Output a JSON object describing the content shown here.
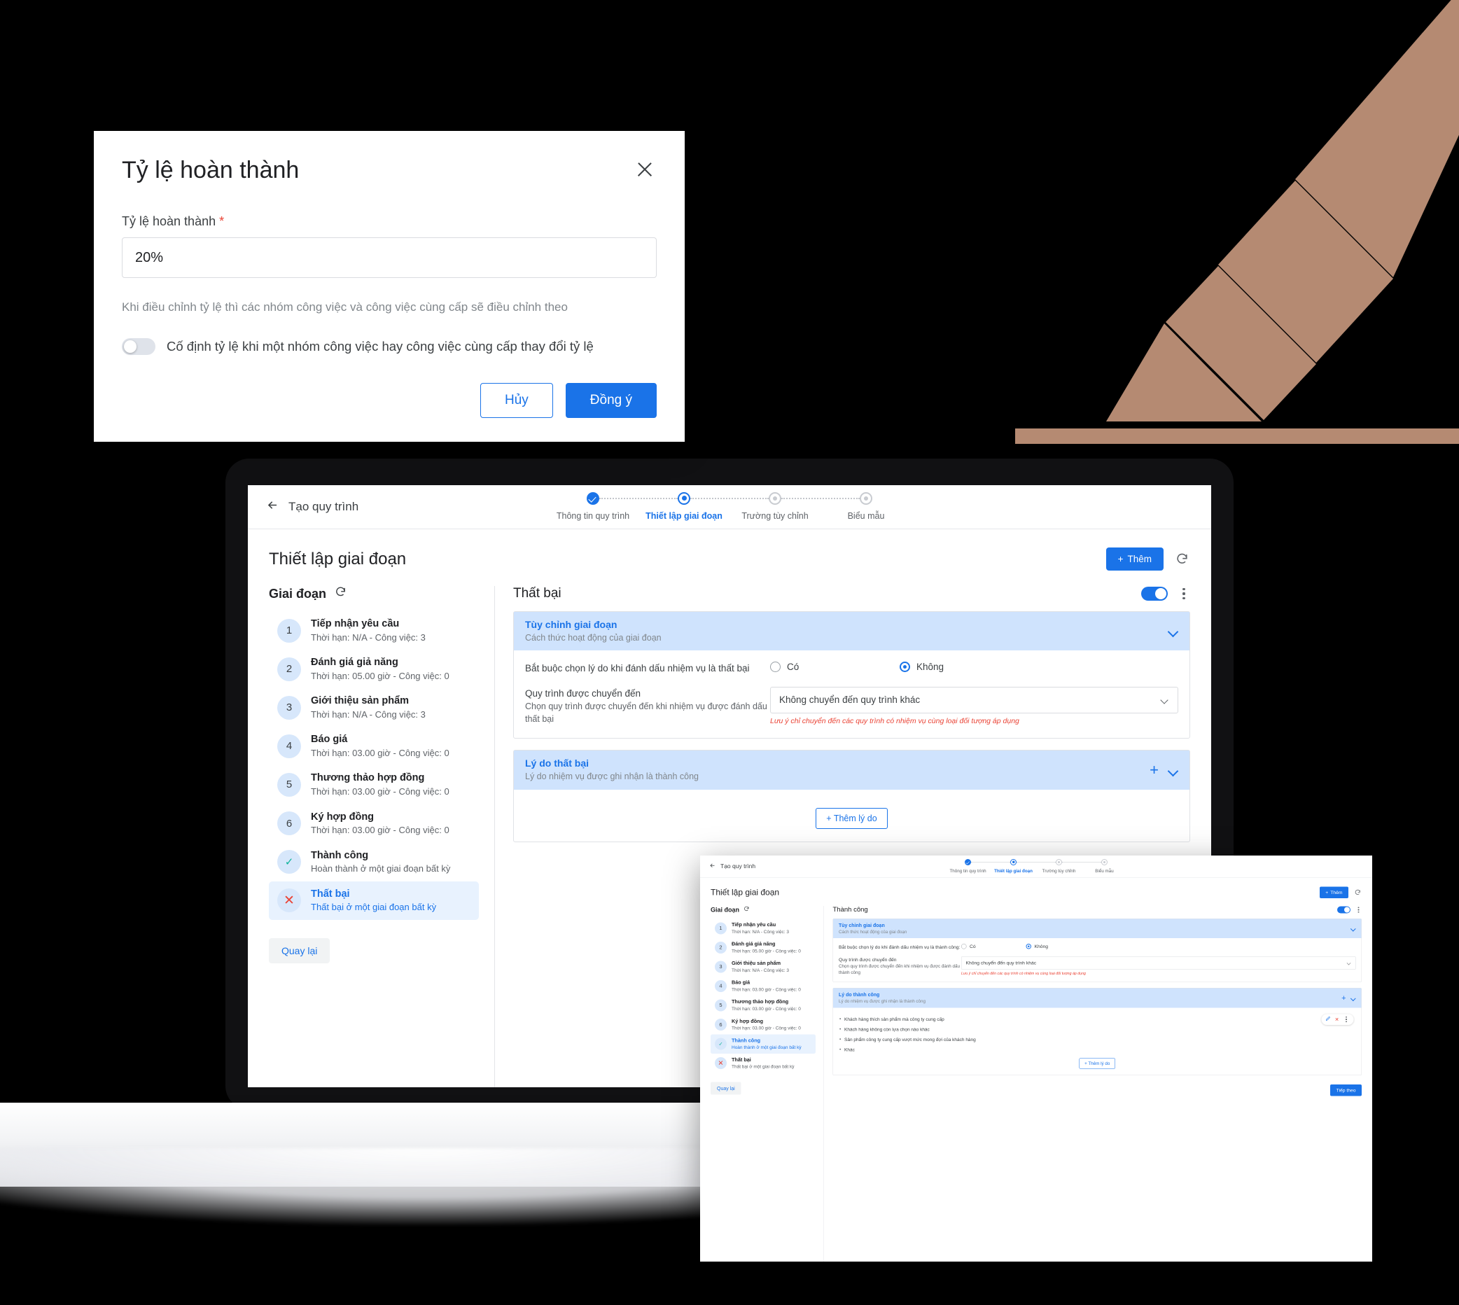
{
  "modal": {
    "title": "Tỷ lệ hoàn thành",
    "field_label": "Tỷ lệ hoàn thành",
    "required_mark": "*",
    "field_value": "20%",
    "note": "Khi điều chỉnh tỷ lệ thì các nhóm công việc và công việc cùng cấp sẽ điều chỉnh theo",
    "toggle_label": "Cố định tỷ lệ khi một nhóm công việc hay công việc cùng cấp thay đổi tỷ lệ",
    "toggle_state": "off",
    "cancel_label": "Hủy",
    "confirm_label": "Đồng ý",
    "close_icon": "close-icon"
  },
  "app": {
    "back_label": "Tạo quy trình",
    "back_icon": "arrow-left-icon",
    "steps": [
      {
        "label": "Thông tin quy trình",
        "state": "done"
      },
      {
        "label": "Thiết lập giai đoạn",
        "state": "active"
      },
      {
        "label": "Trường tùy chỉnh",
        "state": "todo"
      },
      {
        "label": "Biểu mẫu",
        "state": "todo"
      }
    ],
    "page_title": "Thiết lập giai đoạn",
    "add_label": "Thêm",
    "add_icon": "plus-icon",
    "refresh_icon": "refresh-icon",
    "stages_title": "Giai đoạn",
    "stages_refresh_icon": "refresh-icon",
    "stages": [
      {
        "num": "1",
        "name": "Tiếp nhận yêu cầu",
        "meta": "Thời hạn: N/A - Công việc: 3"
      },
      {
        "num": "2",
        "name": "Đánh giá giả năng",
        "meta": "Thời hạn: 05.00 giờ - Công việc: 0"
      },
      {
        "num": "3",
        "name": "Giới thiệu sản phẩm",
        "meta": "Thời hạn: N/A - Công việc: 3"
      },
      {
        "num": "4",
        "name": "Báo giá",
        "meta": "Thời hạn: 03.00 giờ - Công việc: 0"
      },
      {
        "num": "5",
        "name": "Thương thảo hợp đồng",
        "meta": "Thời hạn: 03.00 giờ - Công việc: 0"
      },
      {
        "num": "6",
        "name": "Ký hợp đồng",
        "meta": "Thời hạn: 03.00 giờ - Công việc: 0"
      },
      {
        "num": "✓",
        "name": "Thành công",
        "meta": "Hoàn thành ở một giai đoạn bất kỳ",
        "kind": "ok"
      },
      {
        "num": "✕",
        "name": "Thất bại",
        "meta": "Thất bại ở một giai đoạn bất kỳ",
        "kind": "fail"
      }
    ],
    "back_button_label": "Quay lại",
    "next_button_label": "Tiếp theo"
  },
  "window1": {
    "selected_stage_index": 7,
    "panel_title": "Thất bại",
    "panel_toggle_state": "on",
    "menu_icon": "kebab-menu-icon",
    "custom_card": {
      "title": "Tùy chỉnh giai đoạn",
      "subtitle": "Cách thức hoạt động của giai đoạn",
      "collapse_icon": "chevron-down-icon",
      "require_reason_label": "Bắt buộc chọn lý do khi đánh dấu nhiệm vụ là thất bại",
      "options": [
        {
          "label": "Có",
          "selected": false
        },
        {
          "label": "Không",
          "selected": true
        }
      ],
      "transfer_label": "Quy trình được chuyển đến",
      "transfer_hint": "Chọn quy trình được chuyển đến khi nhiệm vụ được đánh dấu thất bại",
      "transfer_value": "Không chuyển đến quy trình khác",
      "transfer_note": "Lưu ý chỉ chuyển đến các quy trình có nhiệm vụ cùng loại đối tượng áp dụng",
      "dropdown_icon": "chevron-down-icon"
    },
    "reason_card": {
      "title": "Lý do thất bại",
      "subtitle": "Lý do nhiệm vụ được ghi nhận là thành công",
      "add_icon": "plus-icon",
      "collapse_icon": "chevron-down-icon",
      "reasons": [],
      "add_reason_label": "+ Thêm lý do"
    }
  },
  "window2": {
    "selected_stage_index": 6,
    "panel_title": "Thành công",
    "panel_toggle_state": "on",
    "menu_icon": "kebab-menu-icon",
    "custom_card": {
      "title": "Tùy chỉnh giai đoạn",
      "subtitle": "Cách thức hoạt động của giai đoạn",
      "collapse_icon": "chevron-down-icon",
      "require_reason_label": "Bắt buộc chọn lý do khi đánh dấu nhiệm vụ là thành công:",
      "options": [
        {
          "label": "Có",
          "selected": false
        },
        {
          "label": "Không",
          "selected": true
        }
      ],
      "transfer_label": "Quy trình được chuyển đến",
      "transfer_hint": "Chọn quy trình được chuyển đến khi nhiệm vụ được đánh dấu thành công",
      "transfer_value": "Không chuyển đến quy trình khác",
      "transfer_note": "Lưu ý chỉ chuyển đến các quy trình có nhiệm vụ cùng loại đối tượng áp dụng",
      "dropdown_icon": "chevron-down-icon"
    },
    "reason_card": {
      "title": "Lý do thành công",
      "subtitle": "Lý do nhiệm vụ được ghi nhận là thành công",
      "add_icon": "plus-icon",
      "collapse_icon": "chevron-down-icon",
      "reasons": [
        "Khách hàng thích sản phẩm mà công ty cung cấp",
        "Khách hàng không còn lựa chọn nào khác",
        "Sản phẩm công ty cung cấp vượt mức mong đợi của khách hàng",
        "Khác"
      ],
      "row_actions": {
        "edit_icon": "pencil-edit-icon",
        "delete_icon": "close-x-icon",
        "more_icon": "kebab-menu-icon"
      },
      "add_reason_label": "+ Thêm lý do"
    }
  },
  "decoration": {
    "pencil_icon": "pencil-illustration",
    "pencil_color": "#b58a72",
    "background_color": "#000000"
  }
}
